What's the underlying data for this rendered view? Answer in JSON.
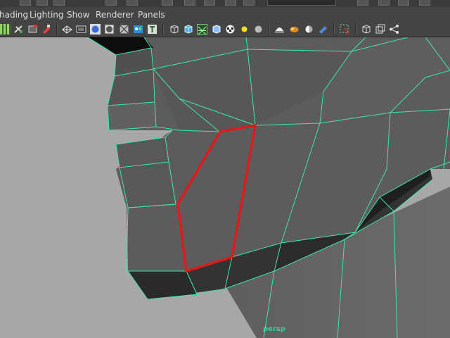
{
  "menubar": {
    "items": [
      {
        "label": "hading"
      },
      {
        "label": "Lighting"
      },
      {
        "label": "Show"
      },
      {
        "label": "Renderer"
      },
      {
        "label": "Panels"
      }
    ]
  },
  "toolbar": {
    "icons": [
      "grid-icon",
      "camera-attributes-icon",
      "bookmark-icon",
      "image-plane-icon",
      "wireframe-icon",
      "film-gate-icon",
      "shaded-sphere-icon",
      "flat-shaded-icon",
      "xray-icon",
      "uv-texture-icon",
      "text-icon",
      "wireframe-cube-icon",
      "smooth-shade-cube-icon",
      "wireframe-on-shaded-icon",
      "bounding-box-icon",
      "checker-icon",
      "default-light-icon",
      "all-lights-icon",
      "shadows-icon",
      "ambient-occlusion-icon",
      "motion-blur-icon",
      "anti-aliasing-icon",
      "isolate-select-icon",
      "xray-joints-icon",
      "xray-active-icon",
      "grease-pencil-icon"
    ]
  },
  "viewport": {
    "camera": "persp",
    "wire_color": "#3fe7a7",
    "selection_color": "#e01a1a"
  }
}
